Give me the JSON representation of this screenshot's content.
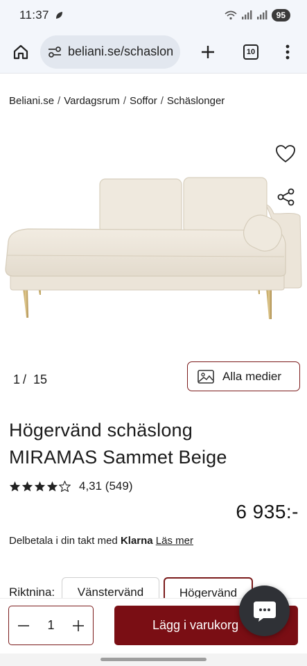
{
  "status_bar": {
    "time": "11:37",
    "battery": "95",
    "icons": [
      "leaf-icon",
      "wifi-icon",
      "signal-icon",
      "signal-icon"
    ]
  },
  "browser": {
    "url": "beliani.se/schaslon",
    "tabs_count": "10",
    "icons": [
      "home-icon",
      "site-settings-icon",
      "plus-icon",
      "more-vertical-icon"
    ]
  },
  "breadcrumb": [
    "Beliani.se",
    "Vardagsrum",
    "Soffor",
    "Schäslonger"
  ],
  "breadcrumb_separator": "/",
  "gallery": {
    "current": "1",
    "separator": "/",
    "total": "15",
    "media_button_label": "Alla medier",
    "icons": [
      "heart-icon",
      "share-icon",
      "image-icon"
    ]
  },
  "product": {
    "title_line1": "Högervänd schäslong",
    "title_line2": "MIRAMAS Sammet Beige",
    "rating_stars": 4.31,
    "rating_text": "4,31 (549)",
    "price": "6 935:-",
    "klarna_prefix": "Delbetala i din takt med",
    "klarna_brand": "Klarna",
    "klarna_link": "Läs mer"
  },
  "direction": {
    "label": "Riktnina:",
    "options": [
      "Vänstervänd",
      "Högervänd"
    ],
    "selected": "Högervänd"
  },
  "cart": {
    "quantity": "1",
    "add_label": "Lägg i varukorg",
    "icons": [
      "minus-icon",
      "plus-icon",
      "chat-icon"
    ]
  },
  "colors": {
    "brand": "#7a0e14",
    "accent_border": "#7a1a1a",
    "chrome_bg": "#f3f6fb"
  }
}
